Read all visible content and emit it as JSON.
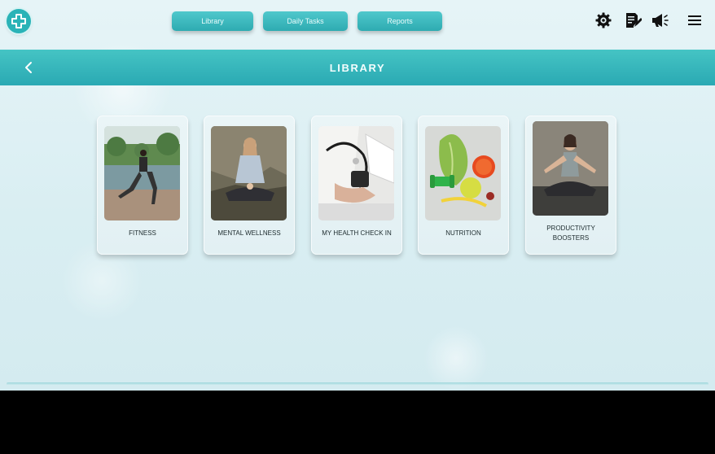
{
  "nav": {
    "library": "Library",
    "daily_tasks": "Daily Tasks",
    "reports": "Reports"
  },
  "toolbar": {
    "icons": [
      "gear-icon",
      "notes-icon",
      "megaphone-icon",
      "menu-icon"
    ]
  },
  "header": {
    "title": "LIBRARY"
  },
  "cards": [
    {
      "label": "FITNESS",
      "image": "fitness-photo"
    },
    {
      "label": "MENTAL WELLNESS",
      "image": "meditation-photo"
    },
    {
      "label": "MY HEALTH CHECK IN",
      "image": "health-checkup-photo"
    },
    {
      "label": "NUTRITION",
      "image": "nutrition-photo"
    },
    {
      "label": "PRODUCTIVITY BOOSTERS",
      "image": "yoga-photo"
    }
  ],
  "colors": {
    "accent": "#2eabb1",
    "header_band": "#36b5bb",
    "background": "#e2f1f4"
  }
}
